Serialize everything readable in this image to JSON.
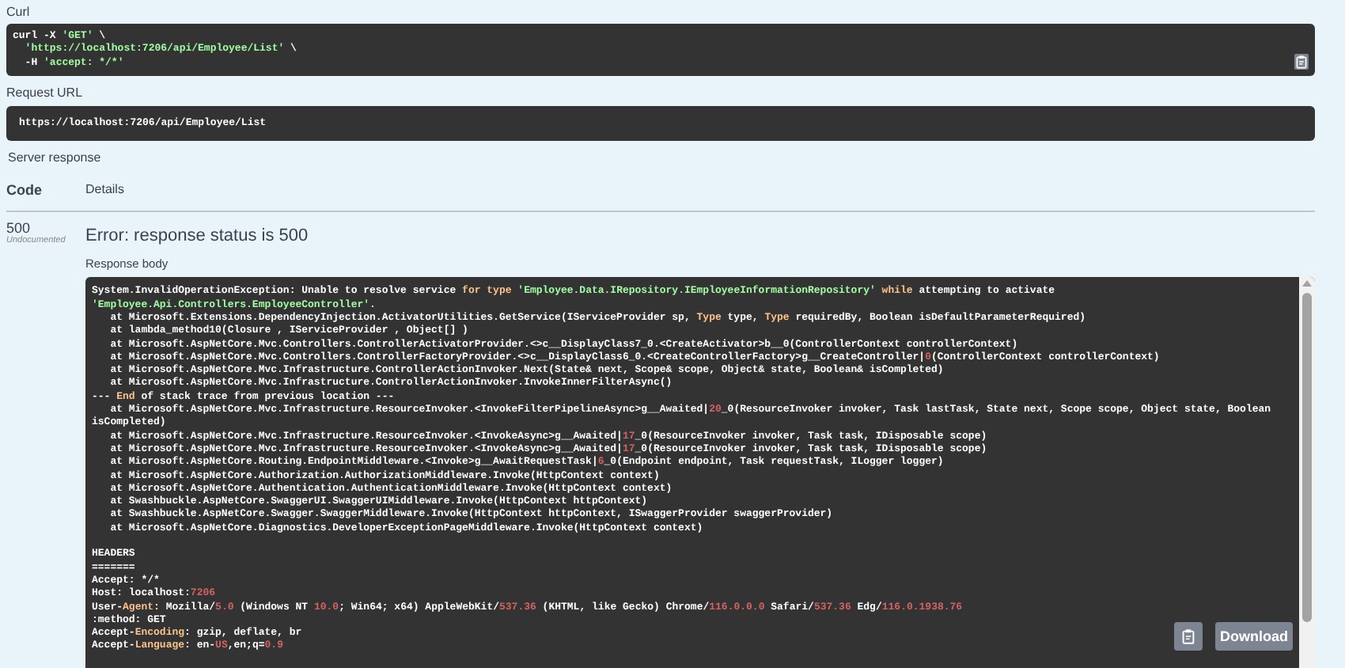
{
  "curl": {
    "label": "Curl",
    "lines": [
      [
        {
          "kind": "plain",
          "text": "curl -X "
        },
        {
          "kind": "string",
          "text": "'GET'"
        },
        {
          "kind": "plain",
          "text": " \\"
        }
      ],
      [
        {
          "kind": "string",
          "text": "  'https://localhost:7206/api/Employee/List'"
        },
        {
          "kind": "plain",
          "text": " \\"
        }
      ],
      [
        {
          "kind": "plain",
          "text": "  -H "
        },
        {
          "kind": "string",
          "text": "'accept: */*'"
        }
      ]
    ]
  },
  "request_url": {
    "label": "Request URL",
    "value": "https://localhost:7206/api/Employee/List"
  },
  "server_response": {
    "label": "Server response",
    "columns": [
      "Code",
      "Details"
    ],
    "code": "500",
    "code_note": "Undocumented",
    "message": "Error: response status is 500",
    "body_label": "Response body",
    "blocks": [
      {
        "lines": [
          [
            {
              "kind": "plain",
              "text": "System.InvalidOperationException: Unable to resolve service "
            },
            {
              "kind": "keyword",
              "text": "for type"
            },
            {
              "kind": "string",
              "text": " 'Employee.Data.IRepository.IEmployeeInformationRepository'"
            },
            {
              "kind": "keyword",
              "text": " while"
            },
            {
              "kind": "plain",
              "text": " attempting to activate "
            },
            {
              "kind": "string",
              "text": "'Employee.Api.Controllers.EmployeeController'"
            },
            {
              "kind": "plain",
              "text": "."
            }
          ],
          [
            {
              "kind": "plain",
              "text": "   at Microsoft.Extensions.DependencyInjection.ActivatorUtilities.GetService(IServiceProvider sp, "
            },
            {
              "kind": "keyword",
              "text": "Type"
            },
            {
              "kind": "plain",
              "text": " type, "
            },
            {
              "kind": "keyword",
              "text": "Type"
            },
            {
              "kind": "plain",
              "text": " requiredBy, Boolean isDefaultParameterRequired)"
            }
          ],
          [
            {
              "kind": "plain",
              "text": "   at lambda_method10(Closure , IServiceProvider , Object[] )"
            }
          ],
          [
            {
              "kind": "plain",
              "text": "   at Microsoft.AspNetCore.Mvc.Controllers.ControllerActivatorProvider.<>c__DisplayClass7_0.<CreateActivator>b__0(ControllerContext controllerContext)"
            }
          ],
          [
            {
              "kind": "plain",
              "text": "   at Microsoft.AspNetCore.Mvc.Controllers.ControllerFactoryProvider.<>c__DisplayClass6_0.<CreateControllerFactory>g__CreateController|"
            },
            {
              "kind": "number",
              "text": "0"
            },
            {
              "kind": "plain",
              "text": "(ControllerContext controllerContext)"
            }
          ],
          [
            {
              "kind": "plain",
              "text": "   at Microsoft.AspNetCore.Mvc.Infrastructure.ControllerActionInvoker.Next(State& next, Scope& scope, Object& state, Boolean& isCompleted)"
            }
          ],
          [
            {
              "kind": "plain",
              "text": "   at Microsoft.AspNetCore.Mvc.Infrastructure.ControllerActionInvoker.InvokeInnerFilterAsync()"
            }
          ],
          [
            {
              "kind": "plain",
              "text": "--- "
            },
            {
              "kind": "keyword",
              "text": "End"
            },
            {
              "kind": "plain",
              "text": " of stack trace from previous location ---"
            }
          ],
          [
            {
              "kind": "plain",
              "text": "   at Microsoft.AspNetCore.Mvc.Infrastructure.ResourceInvoker.<InvokeFilterPipelineAsync>g__Awaited|"
            },
            {
              "kind": "number",
              "text": "20"
            },
            {
              "kind": "plain",
              "text": "_0(ResourceInvoker invoker, Task lastTask, State next, Scope scope, Object state, Boolean isCompleted)"
            }
          ],
          [
            {
              "kind": "plain",
              "text": "   at Microsoft.AspNetCore.Mvc.Infrastructure.ResourceInvoker.<InvokeAsync>g__Awaited|"
            },
            {
              "kind": "number",
              "text": "17"
            },
            {
              "kind": "plain",
              "text": "_0(ResourceInvoker invoker, Task task, IDisposable scope)"
            }
          ],
          [
            {
              "kind": "plain",
              "text": "   at Microsoft.AspNetCore.Mvc.Infrastructure.ResourceInvoker.<InvokeAsync>g__Awaited|"
            },
            {
              "kind": "number",
              "text": "17"
            },
            {
              "kind": "plain",
              "text": "_0(ResourceInvoker invoker, Task task, IDisposable scope)"
            }
          ],
          [
            {
              "kind": "plain",
              "text": "   at Microsoft.AspNetCore.Routing.EndpointMiddleware.<Invoke>g__AwaitRequestTask|"
            },
            {
              "kind": "number",
              "text": "6"
            },
            {
              "kind": "plain",
              "text": "_0(Endpoint endpoint, Task requestTask, ILogger logger)"
            }
          ],
          [
            {
              "kind": "plain",
              "text": "   at Microsoft.AspNetCore.Authorization.AuthorizationMiddleware.Invoke(HttpContext context)"
            }
          ],
          [
            {
              "kind": "plain",
              "text": "   at Microsoft.AspNetCore.Authentication.AuthenticationMiddleware.Invoke(HttpContext context)"
            }
          ],
          [
            {
              "kind": "plain",
              "text": "   at Swashbuckle.AspNetCore.SwaggerUI.SwaggerUIMiddleware.Invoke(HttpContext httpContext)"
            }
          ],
          [
            {
              "kind": "plain",
              "text": "   at Swashbuckle.AspNetCore.Swagger.SwaggerMiddleware.Invoke(HttpContext httpContext, ISwaggerProvider swaggerProvider)"
            }
          ],
          [
            {
              "kind": "plain",
              "text": "   at Microsoft.AspNetCore.Diagnostics.DeveloperExceptionPageMiddleware.Invoke(HttpContext context)"
            }
          ]
        ]
      },
      {
        "lines": [
          [
            {
              "kind": "plain",
              "text": "HEADERS"
            }
          ],
          [
            {
              "kind": "plain",
              "text": "======="
            }
          ],
          [
            {
              "kind": "plain",
              "text": "Accept: */*"
            }
          ],
          [
            {
              "kind": "plain",
              "text": "Host: localhost:"
            },
            {
              "kind": "number",
              "text": "7206"
            }
          ],
          [
            {
              "kind": "plain",
              "text": "User-"
            },
            {
              "kind": "keyword",
              "text": "Agent"
            },
            {
              "kind": "plain",
              "text": ": Mozilla/"
            },
            {
              "kind": "number",
              "text": "5.0"
            },
            {
              "kind": "plain",
              "text": " (Windows NT "
            },
            {
              "kind": "number",
              "text": "10.0"
            },
            {
              "kind": "plain",
              "text": "; Win64; x64) AppleWebKit/"
            },
            {
              "kind": "number",
              "text": "537.36"
            },
            {
              "kind": "plain",
              "text": " (KHTML, like Gecko) Chrome/"
            },
            {
              "kind": "number",
              "text": "116.0.0.0"
            },
            {
              "kind": "plain",
              "text": " Safari/"
            },
            {
              "kind": "number",
              "text": "537.36"
            },
            {
              "kind": "plain",
              "text": " Edg/"
            },
            {
              "kind": "number",
              "text": "116.0.1938.76"
            }
          ],
          [
            {
              "kind": "plain",
              "text": ":method: GET"
            }
          ],
          [
            {
              "kind": "plain",
              "text": "Accept-"
            },
            {
              "kind": "keyword",
              "text": "Encoding"
            },
            {
              "kind": "plain",
              "text": ": gzip, deflate, br"
            }
          ],
          [
            {
              "kind": "plain",
              "text": "Accept-"
            },
            {
              "kind": "keyword",
              "text": "Language"
            },
            {
              "kind": "plain",
              "text": ": en-"
            },
            {
              "kind": "number",
              "text": "US"
            },
            {
              "kind": "plain",
              "text": ",en;q="
            },
            {
              "kind": "number",
              "text": "0.9"
            }
          ]
        ]
      }
    ],
    "download_button": "Download"
  }
}
